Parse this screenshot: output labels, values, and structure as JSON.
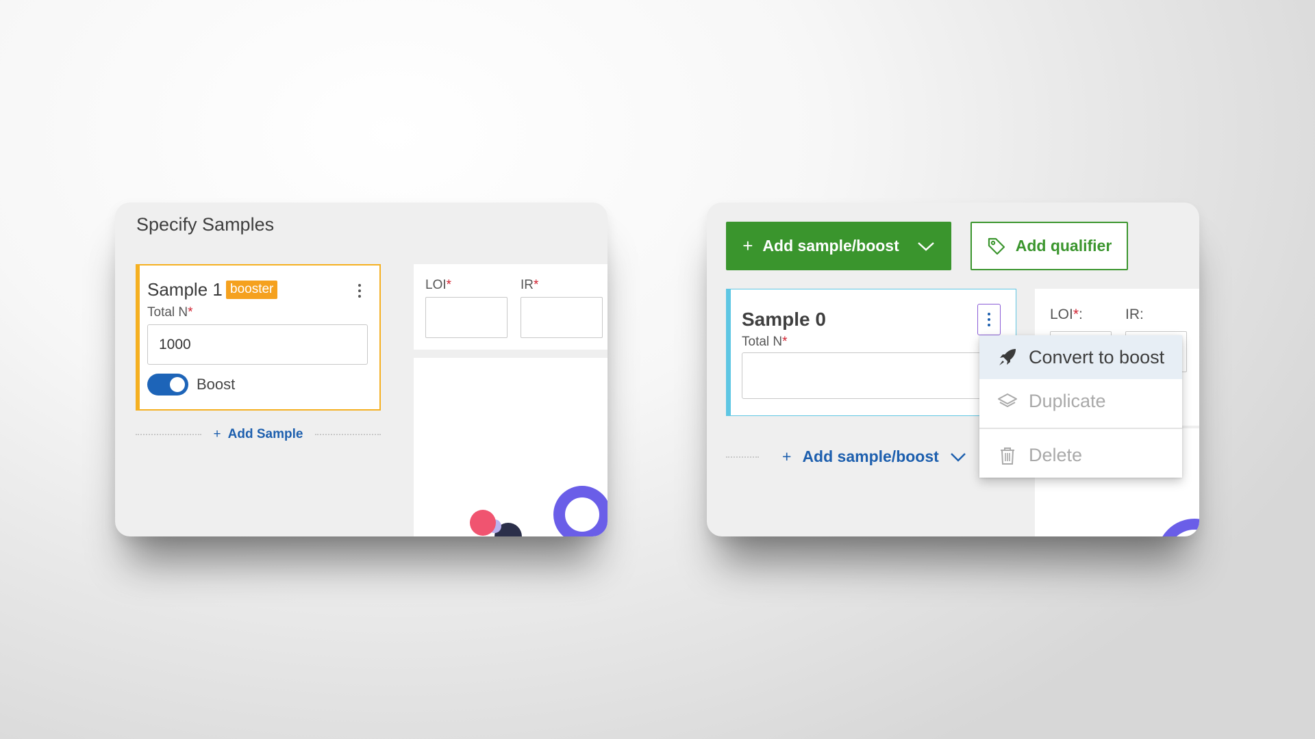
{
  "left_panel": {
    "title": "Specify Samples",
    "sample_card": {
      "title": "Sample 1",
      "badge": "booster",
      "total_label": "Total N",
      "required_mark": "*",
      "total_value": "1000",
      "toggle_label": "Boost",
      "toggle_on": true
    },
    "add_link": {
      "plus": "+",
      "label": "Add Sample"
    },
    "side": {
      "loi_label": "LOI",
      "ir_label": "IR",
      "required_mark": "*"
    }
  },
  "right_panel": {
    "add_button": {
      "plus": "+",
      "label": "Add sample/boost",
      "icon": "chevron-down-icon"
    },
    "qualifier_button": {
      "label": "Add qualifier",
      "icon": "tag-icon"
    },
    "sample_card": {
      "title": "Sample 0",
      "total_label": "Total N",
      "required_mark": "*",
      "total_value": ""
    },
    "side": {
      "loi_label": "LOI",
      "loi_required": "*",
      "loi_colon": ":",
      "ir_label": "IR:"
    },
    "add_link": {
      "plus": "+",
      "label": "Add sample/boost",
      "icon": "chevron-down-icon"
    },
    "context_menu": {
      "items": [
        {
          "label": "Convert to boost",
          "icon": "rocket-icon",
          "state": "hovered"
        },
        {
          "label": "Duplicate",
          "icon": "layers-icon",
          "state": "disabled"
        },
        {
          "label": "Delete",
          "icon": "trash-icon",
          "state": "disabled"
        }
      ]
    }
  },
  "colors": {
    "booster_badge": "#f5a11e",
    "sample1_border": "#f5b021",
    "sample0_border": "#5ec6e3",
    "primary_green": "#3a952d",
    "link_blue": "#1d5fae",
    "toggle_blue": "#1d64b8",
    "required_red": "#d0202f",
    "kebab_focus": "#8a5cd6"
  }
}
